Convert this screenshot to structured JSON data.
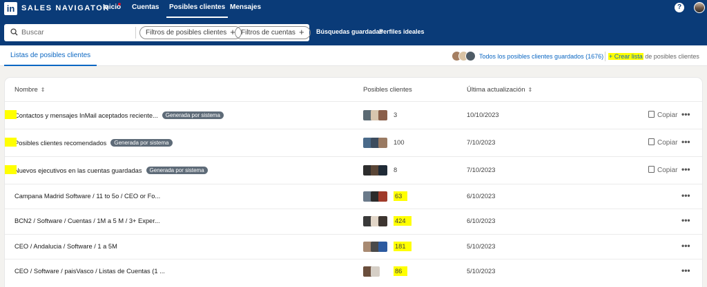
{
  "nav": {
    "logo": "in",
    "brand": "SALES NAVIGATOR",
    "items": [
      "Inicio",
      "Cuentas",
      "Posibles clientes",
      "Mensajes"
    ],
    "help": "?"
  },
  "search": {
    "placeholder": "Buscar",
    "filter_leads": "Filtros de posibles clientes",
    "filter_accounts": "Filtros de cuentas",
    "saved_searches": "Búsquedas guardadas",
    "ideal_profiles": "Perfiles ideales"
  },
  "tabs": {
    "lists": "Listas de posibles clientes",
    "saved_all": "Todos los posibles clientes guardados (1676)",
    "create_prefix": "+ Crear lista",
    "create_suffix": " de posibles clientes"
  },
  "table": {
    "headers": {
      "name": "Nombre",
      "leads": "Posibles clientes",
      "updated": "Última actualización"
    },
    "system_badge": "Generada por sistema",
    "copy_label": "Copiar",
    "more_label": "•••",
    "rows": [
      {
        "name": "Contactos y mensajes InMail aceptados reciente...",
        "system": true,
        "count": "3",
        "date": "10/10/2023",
        "highlight_count": false,
        "copy": true
      },
      {
        "name": "Posibles clientes recomendados",
        "system": true,
        "count": "100",
        "date": "7/10/2023",
        "highlight_count": false,
        "copy": true
      },
      {
        "name": "Nuevos ejecutivos en las cuentas guardadas",
        "system": true,
        "count": "8",
        "date": "7/10/2023",
        "highlight_count": false,
        "copy": true
      },
      {
        "name": "Campana Madrid Software / 11 to 5o / CEO or Fo...",
        "system": false,
        "count": "63",
        "date": "6/10/2023",
        "highlight_count": true,
        "copy": false
      },
      {
        "name": "BCN2 / Software / Cuentas / 1M a 5 M / 3+ Exper...",
        "system": false,
        "count": "424",
        "date": "6/10/2023",
        "highlight_count": true,
        "copy": false
      },
      {
        "name": "CEO / Andalucia / Software / 1 a 5M",
        "system": false,
        "count": "181",
        "date": "5/10/2023",
        "highlight_count": true,
        "copy": false
      },
      {
        "name": "CEO / Software / paisVasco / Listas de Cuentas (1 ...",
        "system": false,
        "count": "86",
        "date": "5/10/2023",
        "highlight_count": true,
        "copy": false
      }
    ]
  },
  "colors": {
    "brand": "#0a3b78",
    "link": "#0a66c2",
    "highlight": "#ffff00"
  }
}
